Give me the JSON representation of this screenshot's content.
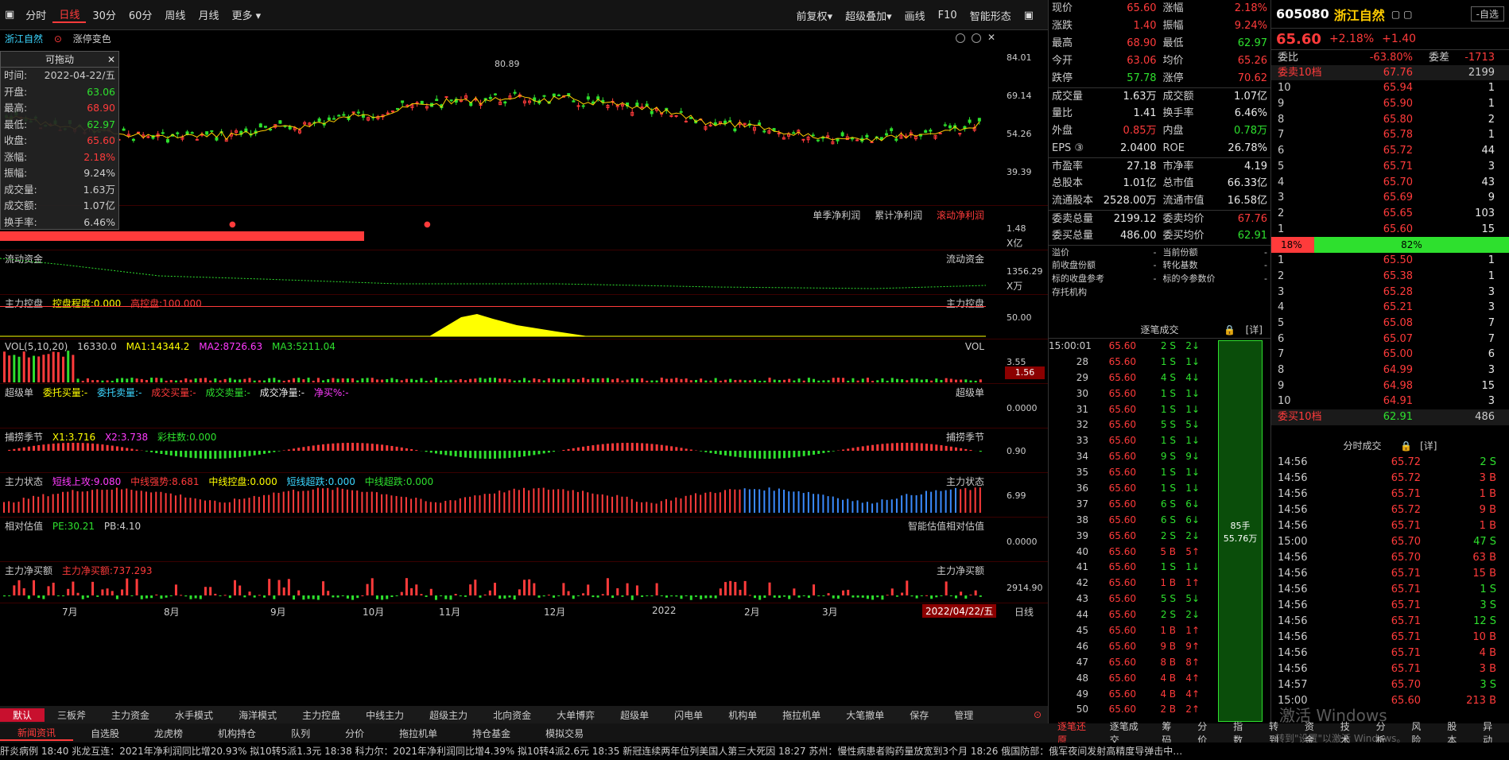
{
  "toolbar": {
    "left": [
      "分时",
      "日线",
      "30分",
      "60分",
      "周线",
      "月线",
      "更多"
    ],
    "active": "日线",
    "right": [
      "前复权",
      "超级叠加",
      "画线",
      "F10",
      "智能形态"
    ]
  },
  "stock": {
    "name": "浙江自然",
    "code": "605080",
    "price": "65.60",
    "pct": "+2.18%",
    "chg": "+1.40",
    "tag": "涨停变色"
  },
  "float_box": {
    "title": "可拖动",
    "rows": [
      {
        "k": "时间:",
        "v": "2022-04-22/五"
      },
      {
        "k": "开盘:",
        "v": "63.06"
      },
      {
        "k": "最高:",
        "v": "68.90"
      },
      {
        "k": "最低:",
        "v": "62.97"
      },
      {
        "k": "收盘:",
        "v": "65.60"
      },
      {
        "k": "涨幅:",
        "v": "2.18%"
      },
      {
        "k": "振幅:",
        "v": "9.24%"
      },
      {
        "k": "成交量:",
        "v": "1.63万"
      },
      {
        "k": "成交额:",
        "v": "1.07亿"
      },
      {
        "k": "换手率:",
        "v": "6.46%"
      }
    ]
  },
  "panels": {
    "p1_axis": [
      "84.01",
      "69.14",
      "54.26",
      "39.39"
    ],
    "p1_marker": "80.89",
    "p2_tabs": [
      "单季净利润",
      "累计净利润",
      "滚动净利润"
    ],
    "p2_axis": [
      "1.48",
      "X亿"
    ],
    "p3_title": "流动资金",
    "p3_axis": [
      "1356.29",
      "X万"
    ],
    "p4_title": "主力控盘",
    "p4_lbl1": "控盘程度:0.000",
    "p4_lbl2": "高控盘:100.000",
    "p4_axis": "50.00",
    "p5_title": "VOL(5,10,20)",
    "p5_vals": [
      "16330.0",
      "MA1:14344.2",
      "MA2:8726.63",
      "MA3:5211.04"
    ],
    "p5_right": "VOL",
    "p5_axis": [
      "3.55",
      "1.56"
    ],
    "p6_title": "超级单",
    "p6_items": [
      "委托买量:-",
      "委托卖量:-",
      "成交买量:-",
      "成交卖量:-",
      "成交净量:-",
      "净买%:-"
    ],
    "p6_axis": "0.0000",
    "p7_title": "捕捞季节",
    "p7_items": [
      "X1:3.716",
      "X2:3.738",
      "彩柱数:0.000"
    ],
    "p7_axis": "0.90",
    "p8_title": "主力状态",
    "p8_items": [
      "短线上攻:9.080",
      "中线强势:8.681",
      "中线控盘:0.000",
      "短线超跌:0.000",
      "中线超跌:0.000"
    ],
    "p8_axis": "6.99",
    "p9_title": "相对估值",
    "p9_items": [
      "PE:30.21",
      "PB:4.10"
    ],
    "p9_right": "智能估值相对估值",
    "p9_axis": "0.0000",
    "p10_title": "主力净买额",
    "p10_item": "主力净买额:737.293",
    "p10_axis": "2914.90"
  },
  "x_axis": [
    "7月",
    "8月",
    "9月",
    "10月",
    "11月",
    "12月",
    "2022",
    "2月",
    "3月"
  ],
  "x_date": "2022/04/22/五",
  "x_period": "日线",
  "tabs1": [
    "默认",
    "三板斧",
    "主力资金",
    "水手模式",
    "海洋模式",
    "主力控盘",
    "中线主力",
    "超级主力",
    "北向资金",
    "大单博弈",
    "超级单",
    "闪电单",
    "机构单",
    "拖拉机单",
    "大笔撤单",
    "保存",
    "管理"
  ],
  "tabs2": [
    "新闻资讯",
    "自选股",
    "龙虎榜",
    "机构持仓",
    "队列",
    "分价",
    "拖拉机单",
    "持仓基金",
    "模拟交易"
  ],
  "ticker": "肝炎病例    18:40 兆龙互连：2021年净利润同比增20.93% 拟10转5派1.3元    18:38 科力尔：2021年净利润同比增4.39% 拟10转4派2.6元    18:35 新冠连续两年位列美国人第三大死因    18:27 苏州：慢性病患者购药量放宽到3个月    18:26 俄国防部：俄军夜间发射高精度导弹击中…",
  "quote": {
    "rows": [
      [
        "现价",
        "65.60",
        "涨幅",
        "2.18%"
      ],
      [
        "涨跌",
        "1.40",
        "振幅",
        "9.24%"
      ],
      [
        "最高",
        "68.90",
        "最低",
        "62.97"
      ],
      [
        "今开",
        "63.06",
        "均价",
        "65.26"
      ],
      [
        "跌停",
        "57.78",
        "涨停",
        "70.62"
      ],
      [
        "成交量",
        "1.63万",
        "成交额",
        "1.07亿"
      ],
      [
        "量比",
        "1.41",
        "换手率",
        "6.46%"
      ],
      [
        "外盘",
        "0.85万",
        "内盘",
        "0.78万"
      ],
      [
        "EPS ③",
        "2.0400",
        "ROE",
        "26.78%"
      ],
      [
        "市盈率",
        "27.18",
        "市净率",
        "4.19"
      ],
      [
        "总股本",
        "1.01亿",
        "总市值",
        "66.33亿"
      ],
      [
        "流通股本",
        "2528.00万",
        "流通市值",
        "16.58亿"
      ],
      [
        "委卖总量",
        "2199.12",
        "委卖均价",
        "67.76"
      ],
      [
        "委买总量",
        "486.00",
        "委买均价",
        "62.91"
      ]
    ],
    "extra": [
      [
        "溢价",
        "-",
        "当前份额",
        "-"
      ],
      [
        "前收盘份额",
        "-",
        "转化基数",
        "-"
      ],
      [
        "标的收盘参考",
        "-",
        "标的今参数价",
        "-"
      ],
      [
        "存托机构",
        "",
        "",
        ""
      ]
    ]
  },
  "book": {
    "wb_label": "委比",
    "wb_val": "-63.80%",
    "wc_label": "委差",
    "wc_val": "-1713",
    "sell_hdr": [
      "委卖10档",
      "67.76",
      "2199"
    ],
    "sell": [
      [
        "10",
        "65.94",
        "1"
      ],
      [
        "9",
        "65.90",
        "1"
      ],
      [
        "8",
        "65.80",
        "2"
      ],
      [
        "7",
        "65.78",
        "1"
      ],
      [
        "6",
        "65.72",
        "44"
      ],
      [
        "5",
        "65.71",
        "3"
      ],
      [
        "4",
        "65.70",
        "43"
      ],
      [
        "3",
        "65.69",
        "9"
      ],
      [
        "2",
        "65.65",
        "103"
      ],
      [
        "1",
        "65.60",
        "15"
      ]
    ],
    "bar_left": "18%",
    "bar_right": "82%",
    "buy": [
      [
        "1",
        "65.50",
        "1"
      ],
      [
        "2",
        "65.38",
        "1"
      ],
      [
        "3",
        "65.28",
        "3"
      ],
      [
        "4",
        "65.21",
        "3"
      ],
      [
        "5",
        "65.08",
        "7"
      ],
      [
        "6",
        "65.07",
        "7"
      ],
      [
        "7",
        "65.00",
        "6"
      ],
      [
        "8",
        "64.99",
        "3"
      ],
      [
        "9",
        "64.98",
        "15"
      ],
      [
        "10",
        "64.91",
        "3"
      ]
    ],
    "buy_hdr": [
      "委买10档",
      "62.91",
      "486"
    ]
  },
  "trades": {
    "title": "逐笔成交",
    "detail": "[详]",
    "bar_top": "85手",
    "bar_bottom": "55.76万",
    "rows": [
      [
        "15:00:01",
        "65.60",
        "2 S",
        "2"
      ],
      [
        "28",
        "65.60",
        "1 S",
        "1"
      ],
      [
        "29",
        "65.60",
        "4 S",
        "4"
      ],
      [
        "30",
        "65.60",
        "1 S",
        "1"
      ],
      [
        "31",
        "65.60",
        "1 S",
        "1"
      ],
      [
        "32",
        "65.60",
        "5 S",
        "5"
      ],
      [
        "33",
        "65.60",
        "1 S",
        "1"
      ],
      [
        "34",
        "65.60",
        "9 S",
        "9"
      ],
      [
        "35",
        "65.60",
        "1 S",
        "1"
      ],
      [
        "36",
        "65.60",
        "1 S",
        "1"
      ],
      [
        "37",
        "65.60",
        "6 S",
        "6"
      ],
      [
        "38",
        "65.60",
        "6 S",
        "6"
      ],
      [
        "39",
        "65.60",
        "2 S",
        "2"
      ],
      [
        "40",
        "65.60",
        "5 B",
        "5"
      ],
      [
        "41",
        "65.60",
        "1 S",
        "1"
      ],
      [
        "42",
        "65.60",
        "1 B",
        "1"
      ],
      [
        "43",
        "65.60",
        "5 S",
        "5"
      ],
      [
        "44",
        "65.60",
        "2 S",
        "2"
      ],
      [
        "45",
        "65.60",
        "1 B",
        "1"
      ],
      [
        "46",
        "65.60",
        "9 B",
        "9"
      ],
      [
        "47",
        "65.60",
        "8 B",
        "8"
      ],
      [
        "48",
        "65.60",
        "4 B",
        "4"
      ],
      [
        "49",
        "65.60",
        "4 B",
        "4"
      ],
      [
        "50",
        "65.60",
        "2 B",
        "2"
      ]
    ]
  },
  "min_trades": {
    "title": "分时成交",
    "detail": "[详]",
    "rows": [
      [
        "14:56",
        "65.72",
        "2 S"
      ],
      [
        "14:56",
        "65.72",
        "3 B"
      ],
      [
        "14:56",
        "65.71",
        "1 B"
      ],
      [
        "14:56",
        "65.72",
        "9 B"
      ],
      [
        "14:56",
        "65.71",
        "1 B"
      ],
      [
        "15:00",
        "65.70",
        "47 S"
      ],
      [
        "14:56",
        "65.70",
        "63 B"
      ],
      [
        "14:56",
        "65.71",
        "15 B"
      ],
      [
        "14:56",
        "65.71",
        "1 S"
      ],
      [
        "14:56",
        "65.71",
        "3 S"
      ],
      [
        "14:56",
        "65.71",
        "12 S"
      ],
      [
        "14:56",
        "65.71",
        "10 B"
      ],
      [
        "14:56",
        "65.71",
        "4 B"
      ],
      [
        "14:56",
        "65.71",
        "3 B"
      ],
      [
        "14:57",
        "65.70",
        "3 S"
      ],
      [
        "15:00",
        "65.60",
        "213 B"
      ]
    ]
  },
  "right_tabs": [
    "逐笔还原",
    "逐笔成交",
    "筹码",
    "分价",
    "指数",
    "转到",
    "资金",
    "技术",
    "分析",
    "风险",
    "股本",
    "异动"
  ],
  "watermark": [
    "激活 Windows",
    "转到\"设置\"以激活 Windows。"
  ],
  "colors": {
    "up": "#ff3b3b",
    "down": "#2ee02e",
    "accent": "#c8102e"
  }
}
